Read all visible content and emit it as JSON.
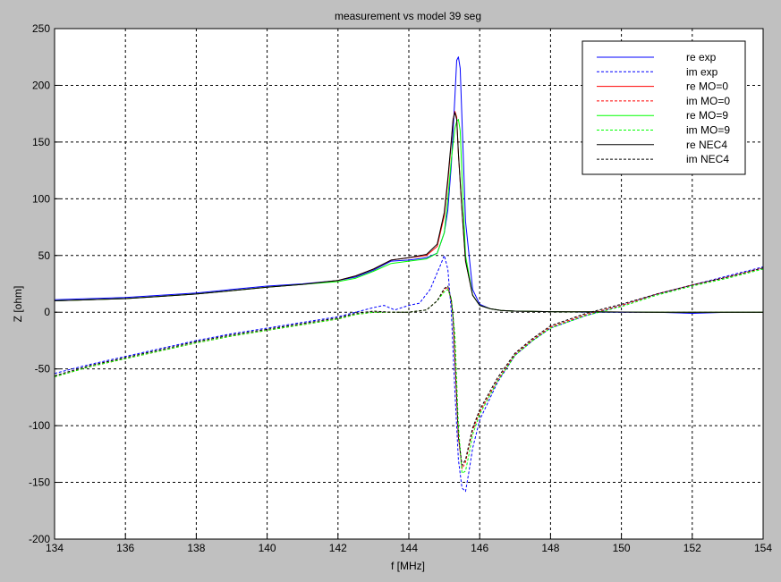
{
  "figure": {
    "background": "#c0c0c0",
    "axes_background": "#ffffff"
  },
  "chart_data": {
    "type": "line",
    "title": "measurement vs model 39 seg",
    "xlabel": "f [MHz]",
    "ylabel": "Z [ohm]",
    "xlim": [
      134,
      154
    ],
    "ylim": [
      -200,
      250
    ],
    "xticks": [
      "134",
      "136",
      "138",
      "140",
      "142",
      "144",
      "146",
      "148",
      "150",
      "152",
      "154"
    ],
    "yticks": [
      "-200",
      "-150",
      "-100",
      "-50",
      "0",
      "50",
      "100",
      "150",
      "200",
      "250"
    ],
    "grid": true,
    "legend_position": "top-right",
    "series": [
      {
        "name": "re exp",
        "color": "#0000ff",
        "dash": "solid",
        "x": [
          134,
          135,
          136,
          137,
          138,
          139,
          140,
          141,
          142,
          142.5,
          143,
          143.5,
          144,
          144.5,
          144.8,
          145,
          145.1,
          145.2,
          145.3,
          145.35,
          145.4,
          145.45,
          145.5,
          145.6,
          145.8,
          146,
          146.3,
          146.6,
          147,
          148,
          149,
          150,
          151,
          152,
          153,
          154
        ],
        "y": [
          11,
          12,
          13,
          15,
          17,
          20,
          23,
          25,
          28,
          31,
          37,
          45,
          46,
          48,
          52,
          70,
          90,
          130,
          190,
          222,
          225,
          215,
          170,
          80,
          20,
          7,
          3,
          1.5,
          1,
          0.5,
          0,
          0,
          0,
          -1,
          0,
          0
        ]
      },
      {
        "name": "im exp",
        "color": "#0000ff",
        "dash": "dashed",
        "x": [
          134,
          135,
          136,
          137,
          138,
          139,
          140,
          141,
          142,
          142.5,
          143,
          143.3,
          143.6,
          144,
          144.3,
          144.6,
          144.9,
          145,
          145.1,
          145.2,
          145.3,
          145.4,
          145.5,
          145.6,
          145.7,
          145.8,
          146,
          146.5,
          147,
          147.5,
          148,
          149,
          150,
          151,
          152,
          153,
          154
        ],
        "y": [
          -54,
          -46,
          -39,
          -32,
          -25,
          -19,
          -14,
          -9,
          -4,
          0,
          4,
          6,
          2,
          6,
          8,
          20,
          42,
          50,
          38,
          0,
          -70,
          -130,
          -155,
          -158,
          -140,
          -120,
          -95,
          -62,
          -38,
          -25,
          -14,
          -3,
          6,
          16,
          24,
          32,
          40
        ]
      },
      {
        "name": "re MO=0",
        "color": "#ff0000",
        "dash": "solid",
        "x": [
          134,
          135,
          136,
          137,
          138,
          139,
          140,
          141,
          142,
          142.5,
          143,
          143.5,
          144,
          144.5,
          144.8,
          145,
          145.1,
          145.2,
          145.25,
          145.3,
          145.35,
          145.4,
          145.5,
          145.6,
          145.8,
          146,
          146.3,
          146.6,
          147,
          148,
          149,
          150,
          151,
          152,
          153,
          154
        ],
        "y": [
          10,
          11,
          12,
          14,
          16,
          19,
          22,
          24.5,
          28,
          32,
          38,
          46,
          48,
          50,
          58,
          85,
          115,
          150,
          170,
          177,
          172,
          140,
          90,
          45,
          15,
          6,
          3,
          1.5,
          1,
          0.5,
          0.3,
          0.2,
          0,
          0,
          0,
          0
        ]
      },
      {
        "name": "im MO=0",
        "color": "#ff0000",
        "dash": "dashed",
        "x": [
          134,
          135,
          136,
          137,
          138,
          139,
          140,
          141,
          142,
          142.5,
          143,
          143.5,
          144,
          144.5,
          144.8,
          145,
          145.1,
          145.2,
          145.25,
          145.3,
          145.4,
          145.5,
          145.6,
          145.7,
          145.8,
          146,
          146.5,
          147,
          147.5,
          148,
          149,
          150,
          151,
          152,
          153,
          154
        ],
        "y": [
          -57,
          -48,
          -41,
          -34,
          -27,
          -21,
          -16,
          -11,
          -6,
          -2,
          0,
          0,
          0,
          2,
          10,
          20,
          22,
          10,
          -5,
          -40,
          -110,
          -138,
          -132,
          -118,
          -104,
          -88,
          -60,
          -37,
          -24,
          -13,
          -2,
          6,
          16,
          24,
          31,
          39
        ]
      },
      {
        "name": "re MO=9",
        "color": "#00ff00",
        "dash": "solid",
        "x": [
          134,
          135,
          136,
          137,
          138,
          139,
          140,
          141,
          142,
          142.5,
          143,
          143.5,
          144,
          144.5,
          144.8,
          145,
          145.1,
          145.2,
          145.3,
          145.35,
          145.4,
          145.45,
          145.5,
          145.6,
          145.8,
          146,
          146.3,
          146.6,
          147,
          148,
          149,
          150,
          151,
          152,
          153,
          154
        ],
        "y": [
          10,
          11,
          12,
          14,
          16,
          19,
          22,
          24.5,
          27,
          30,
          36,
          43,
          45,
          47,
          52,
          70,
          100,
          135,
          162,
          168,
          170,
          160,
          120,
          50,
          15,
          6,
          3,
          1.5,
          1,
          0.5,
          0.3,
          0.2,
          0,
          0,
          0,
          0
        ]
      },
      {
        "name": "im MO=9",
        "color": "#00ff00",
        "dash": "dashed",
        "x": [
          134,
          135,
          136,
          137,
          138,
          139,
          140,
          141,
          142,
          142.5,
          143,
          143.5,
          144,
          144.5,
          144.8,
          145,
          145.1,
          145.2,
          145.3,
          145.4,
          145.5,
          145.6,
          145.7,
          145.8,
          146,
          146.5,
          147,
          147.5,
          148,
          149,
          150,
          151,
          152,
          153,
          154
        ],
        "y": [
          -57,
          -48,
          -41,
          -34,
          -27,
          -21,
          -16,
          -11,
          -6,
          -2,
          0,
          0,
          0,
          2,
          10,
          18,
          20,
          12,
          -20,
          -100,
          -142,
          -140,
          -125,
          -108,
          -90,
          -61,
          -38,
          -25,
          -14,
          -3,
          5,
          15,
          23,
          30,
          38
        ]
      },
      {
        "name": "re NEC4",
        "color": "#000000",
        "dash": "solid",
        "x": [
          134,
          135,
          136,
          137,
          138,
          139,
          140,
          141,
          142,
          142.5,
          143,
          143.5,
          144,
          144.5,
          144.8,
          145,
          145.1,
          145.2,
          145.25,
          145.3,
          145.35,
          145.4,
          145.5,
          145.6,
          145.8,
          146,
          146.3,
          146.6,
          147,
          148,
          149,
          150,
          151,
          152,
          153,
          154
        ],
        "y": [
          10,
          11,
          12,
          14,
          16,
          19,
          22,
          24.5,
          28,
          32,
          38,
          46,
          48,
          51,
          60,
          88,
          118,
          152,
          170,
          176,
          170,
          140,
          90,
          45,
          15,
          6,
          3,
          1.5,
          1,
          0.5,
          0.3,
          0.2,
          0,
          0,
          0,
          0
        ]
      },
      {
        "name": "im NEC4",
        "color": "#000000",
        "dash": "dashed",
        "x": [
          134,
          135,
          136,
          137,
          138,
          139,
          140,
          141,
          142,
          142.5,
          143,
          143.5,
          144,
          144.5,
          144.8,
          145,
          145.1,
          145.2,
          145.25,
          145.3,
          145.4,
          145.5,
          145.6,
          145.7,
          145.8,
          146,
          146.5,
          147,
          147.5,
          148,
          149,
          150,
          151,
          152,
          153,
          154
        ],
        "y": [
          -56,
          -47,
          -40,
          -33,
          -26,
          -20,
          -15,
          -10,
          -5,
          -1,
          1,
          0,
          0,
          2,
          10,
          21,
          23,
          10,
          -5,
          -40,
          -110,
          -135,
          -130,
          -116,
          -102,
          -86,
          -58,
          -36,
          -23,
          -12,
          -1,
          7,
          16,
          24,
          31,
          39
        ]
      }
    ]
  }
}
